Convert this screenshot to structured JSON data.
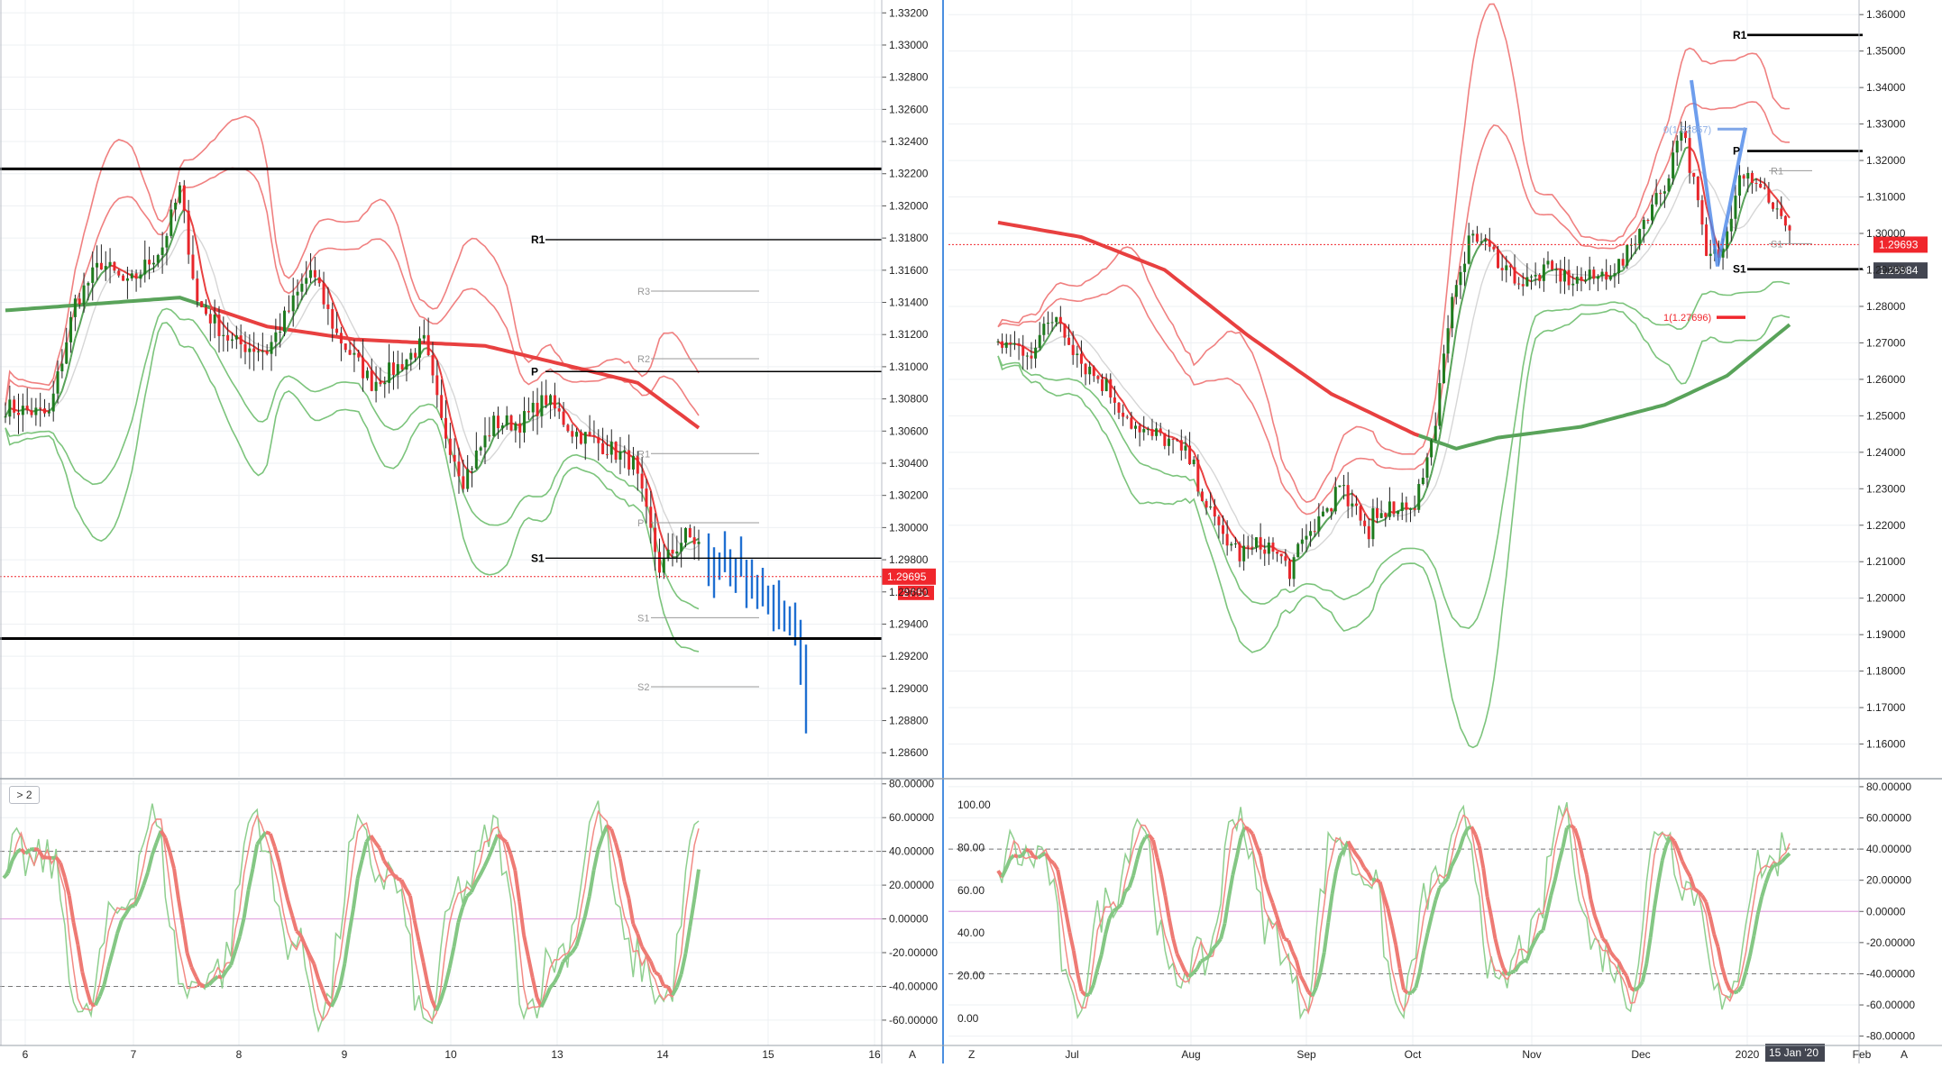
{
  "ui": {
    "left_indicator_tag": "> 2",
    "left_scale_button": "A",
    "right_scale_button": "A",
    "right_zoom_button": "Z",
    "crosshair_date": "15 Jan '20"
  },
  "colors": {
    "up_candle": "#1e7b1e",
    "down_candle": "#e8262b",
    "forecast_bar": "#1f6fd1",
    "ma_red": "#e84040",
    "ma_green": "#59a35a",
    "band_red": "#f08080",
    "band_green": "#7cc47c",
    "price_tag": "#f0262c",
    "dark_tag": "#434651",
    "pivot_line": "#000000",
    "stoch_k": "#f28a84",
    "stoch_d": "#8fcf8f"
  },
  "chart_data": [
    {
      "id": "left-price",
      "type": "candlestick",
      "x_ticks": [
        "6",
        "7",
        "8",
        "9",
        "10",
        "13",
        "14",
        "15",
        "16"
      ],
      "y_ticks": [
        "1.33200",
        "1.33000",
        "1.32800",
        "1.32600",
        "1.32400",
        "1.32200",
        "1.32000",
        "1.31800",
        "1.31600",
        "1.31400",
        "1.31200",
        "1.31000",
        "1.30800",
        "1.30600",
        "1.30400",
        "1.30200",
        "1.30000",
        "1.29800",
        "1.29600",
        "1.29400",
        "1.29200",
        "1.29000",
        "1.28800",
        "1.28600"
      ],
      "ylim": [
        1.2845,
        1.3328
      ],
      "last_price_label": "1.29695",
      "last_price": 1.29695,
      "countdown_label": "27:51",
      "horizontal_levels": [
        {
          "label": "",
          "value": 1.3223
        },
        {
          "label": "R1",
          "value": 1.3179
        },
        {
          "label": "P",
          "value": 1.3097
        },
        {
          "label": "S1",
          "value": 1.2981
        },
        {
          "label": "",
          "value": 1.2931
        }
      ],
      "pivot_labels_gray": [
        {
          "label": "R3",
          "value": 1.3147
        },
        {
          "label": "R2",
          "value": 1.3105
        },
        {
          "label": "R1",
          "value": 1.3046
        },
        {
          "label": "P",
          "value": 1.3003
        },
        {
          "label": "S1",
          "value": 1.2944
        },
        {
          "label": "S2",
          "value": 1.2901
        }
      ]
    },
    {
      "id": "left-stoch",
      "type": "line",
      "y_ticks": [
        "80.00000",
        "60.00000",
        "40.00000",
        "20.00000",
        "0.00000",
        "-20.00000",
        "-40.00000",
        "-60.00000"
      ],
      "ylim": [
        -75,
        82
      ],
      "dashed_levels": [
        40,
        -40
      ]
    },
    {
      "id": "right-price",
      "type": "candlestick",
      "x_ticks": [
        "Jul",
        "Aug",
        "Sep",
        "Oct",
        "Nov",
        "Dec",
        "2020",
        "Feb"
      ],
      "y_ticks": [
        "1.36000",
        "1.35000",
        "1.34000",
        "1.33000",
        "1.32000",
        "1.31000",
        "1.30000",
        "1.29000",
        "1.28000",
        "1.27000",
        "1.26000",
        "1.25000",
        "1.24000",
        "1.23000",
        "1.22000",
        "1.21000",
        "1.20000",
        "1.19000",
        "1.18000",
        "1.17000",
        "1.16000"
      ],
      "ylim": [
        1.151,
        1.364
      ],
      "last_price_label": "1.29693",
      "last_price": 1.29693,
      "level_tag_label": "1.28984",
      "level_tag_value": 1.28984,
      "horizontal_levels": [
        {
          "label": "R1",
          "value": 1.3544
        },
        {
          "label": "P",
          "value": 1.3226
        },
        {
          "label": "S1",
          "value": 1.2902
        }
      ],
      "pivot_labels_gray": [
        {
          "label": "R1",
          "value": 1.3172
        },
        {
          "label": "S1",
          "value": 1.2972
        }
      ],
      "fib_labels": [
        {
          "label": "0(1.32857)",
          "value": 1.3286
        },
        {
          "label": "1(1.27696)",
          "value": 1.277
        }
      ]
    },
    {
      "id": "right-stoch",
      "type": "line",
      "y_ticks_left": [
        "100.00",
        "80.00",
        "60.00",
        "40.00",
        "20.00",
        "0.00"
      ],
      "y_ticks_right": [
        "80.00000",
        "60.00000",
        "40.00000",
        "20.00000",
        "0.00000",
        "-20.00000",
        "-40.00000",
        "-60.00000",
        "-80.00000"
      ],
      "ylim": [
        -86,
        84
      ],
      "dashed_levels": [
        40,
        -40
      ]
    }
  ]
}
